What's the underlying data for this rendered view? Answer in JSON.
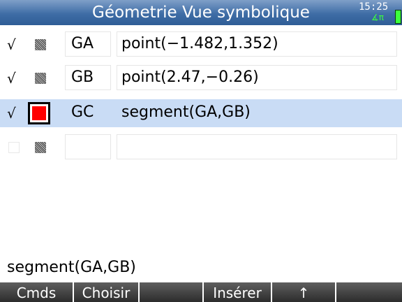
{
  "titlebar": {
    "title": "Géometrie Vue symbolique",
    "time": "15:25",
    "angle_mode": "∡π",
    "battery_color": "#3cff3c",
    "bar_color": "#3f6da6"
  },
  "rows": [
    {
      "checked": true,
      "check_mark": "√",
      "color": "dither-gray",
      "name": "GA",
      "expression": "point(−1.482,1.352)"
    },
    {
      "checked": true,
      "check_mark": "√",
      "color": "dither-gray",
      "name": "GB",
      "expression": "point(2.47,−0.26)"
    },
    {
      "checked": true,
      "check_mark": "√",
      "color": "#ff0000",
      "name": "GC",
      "expression": "segment(GA,GB)",
      "selected": true
    },
    {
      "checked": false,
      "check_mark": "",
      "color": "dither-gray",
      "name": "",
      "expression": ""
    }
  ],
  "edit_line": "segment(GA,GB)",
  "menu": [
    "Cmds",
    "Choisir",
    "",
    "Insérer",
    "↑",
    ""
  ],
  "selection_color": "#c9dcf5"
}
